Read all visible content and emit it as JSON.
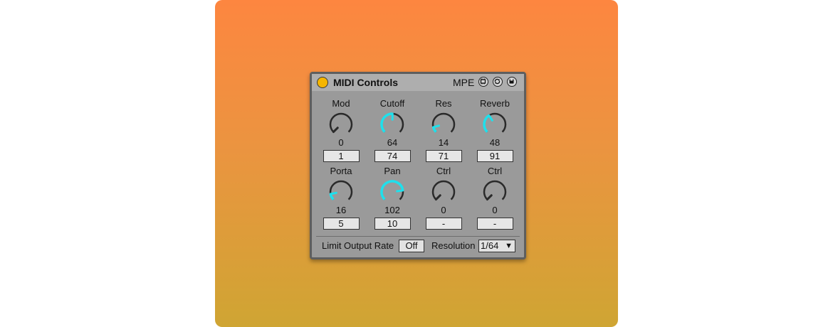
{
  "device": {
    "title": "MIDI Controls",
    "mpe_label": "MPE",
    "title_icons": [
      "map-icon",
      "sync-icon",
      "save-icon"
    ],
    "power_color": "#f5b500"
  },
  "knobs": [
    {
      "label": "Mod",
      "value": "0",
      "cc": "1",
      "level": 0.0
    },
    {
      "label": "Cutoff",
      "value": "64",
      "cc": "74",
      "level": 0.504
    },
    {
      "label": "Res",
      "value": "14",
      "cc": "71",
      "level": 0.11
    },
    {
      "label": "Reverb",
      "value": "48",
      "cc": "91",
      "level": 0.378
    },
    {
      "label": "Porta",
      "value": "16",
      "cc": "5",
      "level": 0.126
    },
    {
      "label": "Pan",
      "value": "102",
      "cc": "10",
      "level": 0.803
    },
    {
      "label": "Ctrl",
      "value": "0",
      "cc": "-",
      "level": 0.0
    },
    {
      "label": "Ctrl",
      "value": "0",
      "cc": "-",
      "level": 0.0
    }
  ],
  "footer": {
    "limit_label": "Limit Output Rate",
    "limit_value": "Off",
    "resolution_label": "Resolution",
    "resolution_value": "1/64"
  },
  "colors": {
    "accent": "#1fe0ec",
    "knob_track": "#2a2a2a",
    "panel": "#9a9a9a",
    "background_top": "#fd8640",
    "background_bottom": "#cfa533"
  }
}
